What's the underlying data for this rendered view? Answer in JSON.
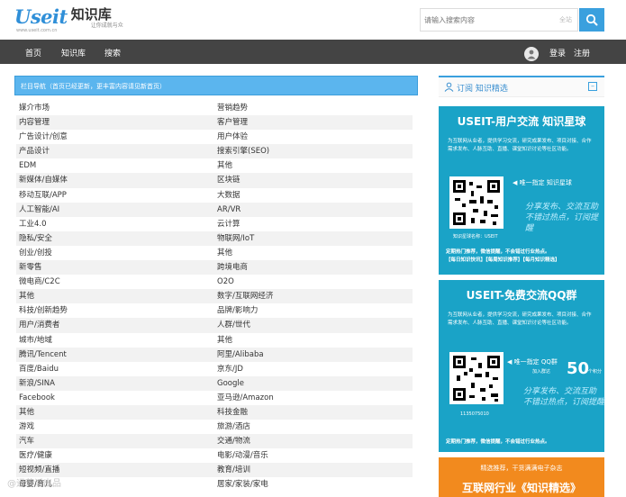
{
  "header": {
    "logo_mark": "Useit",
    "logo_title": "知识库",
    "logo_sub": "让你成就与众",
    "logo_url": "www.useit.com.cn",
    "search_placeholder": "请输入搜索内容",
    "search_scope": "全站"
  },
  "nav": {
    "items": [
      "首页",
      "知识库",
      "搜索"
    ],
    "login": "登录",
    "register": "注册"
  },
  "main": {
    "heading": "栏目导航（首页已经更新，更丰富内容请见新首页）",
    "rows": [
      [
        "媒介市场",
        "营销趋势"
      ],
      [
        "内容管理",
        "客户管理"
      ],
      [
        "广告设计/创意",
        "用户体验"
      ],
      [
        "产品设计",
        "搜索引擎(SEO)"
      ],
      [
        "EDM",
        "其他"
      ],
      [
        "新媒体/自媒体",
        "区块链"
      ],
      [
        "移动互联/APP",
        "大数据"
      ],
      [
        "人工智能/AI",
        "AR/VR"
      ],
      [
        "工业4.0",
        "云计算"
      ],
      [
        "隐私/安全",
        "物联网/IoT"
      ],
      [
        "创业/创投",
        "其他"
      ],
      [
        "新零售",
        "跨境电商"
      ],
      [
        "微电商/C2C",
        "O2O"
      ],
      [
        "其他",
        "数字/互联网经济"
      ],
      [
        "科技/创新趋势",
        "品牌/影响力"
      ],
      [
        "用户/消费者",
        "人群/世代"
      ],
      [
        "城市/地域",
        "其他"
      ],
      [
        "腾讯/Tencent",
        "阿里/Alibaba"
      ],
      [
        "百度/Baidu",
        "京东/JD"
      ],
      [
        "新浪/SINA",
        "Google"
      ],
      [
        "Facebook",
        "亚马逊/Amazon"
      ],
      [
        "其他",
        "科技金融"
      ],
      [
        "游戏",
        "旅游/酒店"
      ],
      [
        "汽车",
        "交通/物流"
      ],
      [
        "医疗/健康",
        "电影/动漫/音乐"
      ],
      [
        "短视频/直播",
        "教育/培训"
      ],
      [
        "母婴/育儿",
        "居家/家装/家电"
      ]
    ]
  },
  "sidebar": {
    "heading": "订阅 知识精选",
    "toggle": "–",
    "promo1": {
      "title": "USEIT-用户交流 知识星球",
      "desc": "为互联网从业者，提供学习交流，研究成果发布、项目对接、合作需求发布、人脉互助、直播、课堂知识讨论等社区功能。",
      "note": "唯一指定 知识星球",
      "slogan1": "分享发布、交流互助",
      "slogan2": "不错过热点，订阅提醒",
      "qr_caption": "知识星球名称：USEIT",
      "foot1": "定期热门推荐，微信提醒，不会错过行业热点。",
      "foot2": "【每日知识快讯】【每周知识推荐】【每月知识精选】"
    },
    "promo2": {
      "title": "USEIT-免费交流QQ群",
      "desc": "为互联网从业者，提供学习交流，研究成果发布、项目对接、合作需求发布、人脉互助、直播、课堂知识讨论等社区功能。",
      "note": "唯一指定 QQ群",
      "count_label": "加入群达",
      "count": "50",
      "count_unit": "个积分",
      "slogan1": "分享发布、交流互助",
      "slogan2": "不错过热点，订阅提醒",
      "qr_caption": "1135075010",
      "foot1": "定期热门推荐，微信提醒，不会错过行业热点。"
    },
    "promo3": {
      "line1": "精选推荐，干货满满电子杂志",
      "line2": "互联网行业《知识精选》"
    }
  },
  "watermark": "@运营派出品",
  "colors": {
    "brand_blue": "#3aa0de",
    "nav_bg": "#444444",
    "promo_teal": "#1aa3c7",
    "promo_orange": "#f28a1e"
  }
}
